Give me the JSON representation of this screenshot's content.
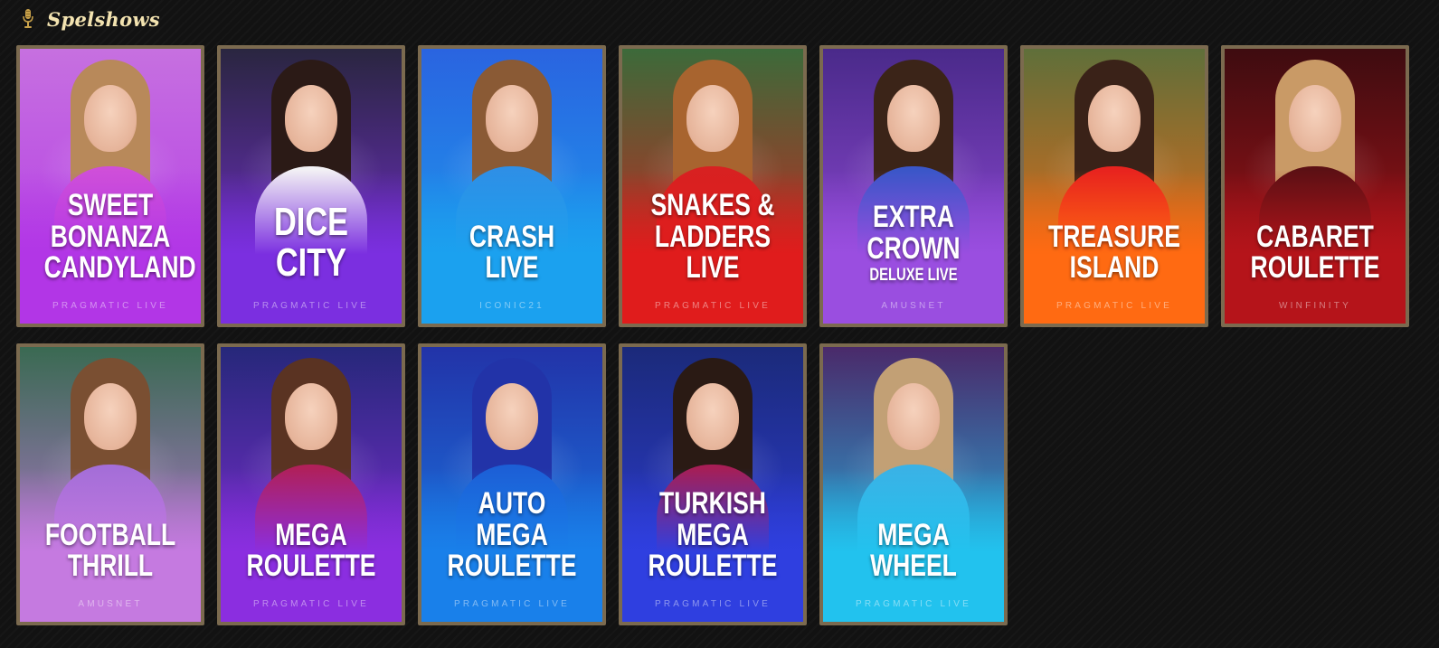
{
  "section": {
    "title": "Spelshows",
    "icon": "microphone-icon"
  },
  "games": [
    {
      "id": "sweet-bonanza-candyland",
      "title": "SWEET BONANZA\nCANDYLAND",
      "subtitle": "",
      "provider": "PRAGMATIC LIVE",
      "size": "s1",
      "colors": {
        "top": "#c670e0",
        "bottom": "#b236e6",
        "hair": "#b8895a",
        "body": "#cf4fd9"
      }
    },
    {
      "id": "dice-city",
      "title": "DICE CITY",
      "subtitle": "",
      "provider": "PRAGMATIC LIVE",
      "size": "s2",
      "colors": {
        "top": "#2a2640",
        "bottom": "#7b2fe0",
        "hair": "#2b1a16",
        "body": "#f2f0f4"
      }
    },
    {
      "id": "crash-live",
      "title": "CRASH LIVE",
      "subtitle": "",
      "provider": "ICONIC21",
      "size": "s1",
      "colors": {
        "top": "#2a64e0",
        "bottom": "#1ba1ef",
        "hair": "#8a5a35",
        "body": "#2e8fe6"
      }
    },
    {
      "id": "snakes-ladders-live",
      "title": "SNAKES &\nLADDERS LIVE",
      "subtitle": "",
      "provider": "PRAGMATIC LIVE",
      "size": "s1",
      "colors": {
        "top": "#3c6a3a",
        "bottom": "#e01c1c",
        "hair": "#a8642f",
        "body": "#d82121"
      }
    },
    {
      "id": "extra-crown",
      "title": "EXTRA CROWN",
      "subtitle": "DELUXE LIVE",
      "provider": "AMUSNET",
      "size": "s1",
      "colors": {
        "top": "#4a2a8a",
        "bottom": "#9a4ee0",
        "hair": "#3b2418",
        "body": "#3a56c8"
      }
    },
    {
      "id": "treasure-island",
      "title": "TREASURE\nISLAND",
      "subtitle": "",
      "provider": "PRAGMATIC LIVE",
      "size": "s1",
      "colors": {
        "top": "#5f6f3a",
        "bottom": "#ff6a12",
        "hair": "#3a2218",
        "body": "#e8231e"
      }
    },
    {
      "id": "cabaret-roulette",
      "title": "CABARET\nROULETTE",
      "subtitle": "",
      "provider": "WINFINITY",
      "size": "s1",
      "colors": {
        "top": "#3e0c10",
        "bottom": "#b5141a",
        "hair": "#c99a66",
        "body": "#5c1014"
      }
    },
    {
      "id": "football-thrill",
      "title": "FOOTBALL\nTHRILL",
      "subtitle": "",
      "provider": "AMUSNET",
      "size": "s1",
      "colors": {
        "top": "#3a6a52",
        "bottom": "#c57ae0",
        "hair": "#7a4f32",
        "body": "#a46ed8"
      }
    },
    {
      "id": "mega-roulette",
      "title": "MEGA ROULETTE",
      "subtitle": "",
      "provider": "PRAGMATIC LIVE",
      "size": "s1",
      "colors": {
        "top": "#26287a",
        "bottom": "#8b2ee0",
        "hair": "#5a3322",
        "body": "#b0205a"
      }
    },
    {
      "id": "auto-mega-roulette",
      "title": "AUTO MEGA\nROULETTE",
      "subtitle": "",
      "provider": "PRAGMATIC LIVE",
      "size": "s1",
      "colors": {
        "top": "#2233a8",
        "bottom": "#1980ea",
        "hair": "#2233a8",
        "body": "#1c5fd6"
      }
    },
    {
      "id": "turkish-mega-roulette",
      "title": "TURKISH MEGA\nROULETTE",
      "subtitle": "",
      "provider": "PRAGMATIC LIVE",
      "size": "s1",
      "colors": {
        "top": "#1b2a7a",
        "bottom": "#2f3fe0",
        "hair": "#2a1a14",
        "body": "#a61e56"
      }
    },
    {
      "id": "mega-wheel",
      "title": "MEGA WHEEL",
      "subtitle": "",
      "provider": "PRAGMATIC LIVE",
      "size": "s1",
      "colors": {
        "top": "#4a2a6a",
        "bottom": "#22c2ee",
        "hair": "#c2a075",
        "body": "#3ab2e6"
      }
    }
  ]
}
